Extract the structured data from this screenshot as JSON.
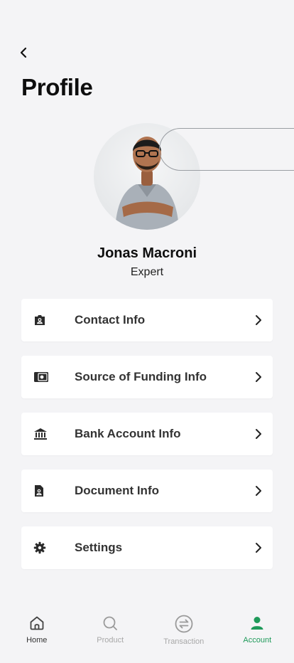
{
  "header": {
    "title": "Profile"
  },
  "profile": {
    "name": "Jonas Macroni",
    "role": "Expert"
  },
  "menu": [
    {
      "label": "Contact Info",
      "icon": "contact-card-icon"
    },
    {
      "label": "Source of Funding Info",
      "icon": "wallet-icon"
    },
    {
      "label": "Bank Account Info",
      "icon": "bank-icon"
    },
    {
      "label": "Document Info",
      "icon": "document-icon"
    },
    {
      "label": "Settings",
      "icon": "gear-icon"
    }
  ],
  "tabs": [
    {
      "label": "Home",
      "icon": "home-icon"
    },
    {
      "label": "Product",
      "icon": "search-icon"
    },
    {
      "label": "Transaction",
      "icon": "transfer-icon"
    },
    {
      "label": "Account",
      "icon": "user-icon"
    }
  ],
  "colors": {
    "accent": "#1f9a5a",
    "background": "#f4f4f6",
    "card": "#ffffff"
  }
}
